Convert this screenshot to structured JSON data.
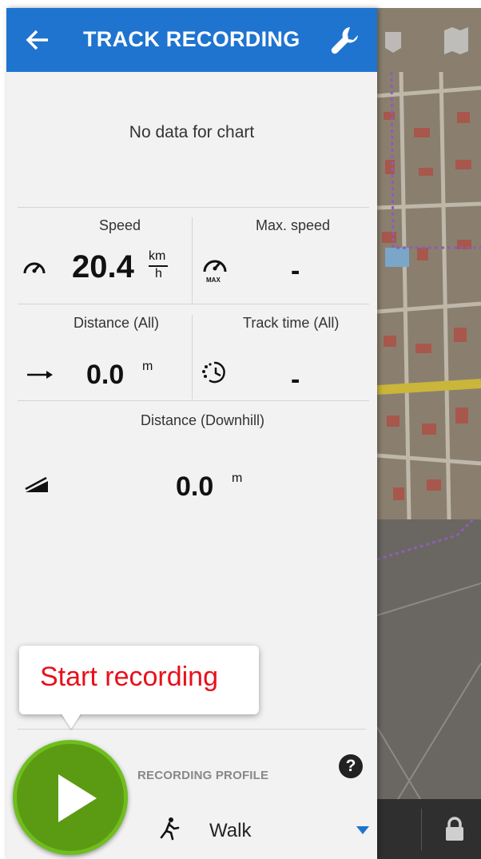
{
  "header": {
    "title": "TRACK RECORDING",
    "back_icon": "arrow-left-icon",
    "settings_icon": "wrench-icon"
  },
  "chart": {
    "empty_message": "No data for chart"
  },
  "stats": {
    "speed": {
      "label": "Speed",
      "value": "20.4",
      "unit_top": "km",
      "unit_bottom": "h",
      "icon": "speedometer-icon"
    },
    "max_speed": {
      "label": "Max. speed",
      "value": "-",
      "icon": "max-speedometer-icon",
      "icon_caption": "MAX"
    },
    "distance_all": {
      "label": "Distance (All)",
      "value": "0.0",
      "unit": "m",
      "icon": "arrow-right-icon"
    },
    "track_time_all": {
      "label": "Track time (All)",
      "value": "-",
      "icon": "timer-icon"
    },
    "distance_downhill": {
      "label": "Distance (Downhill)",
      "value": "0.0",
      "unit": "m",
      "icon": "downhill-icon"
    }
  },
  "tooltip": {
    "text": "Start recording"
  },
  "recording_profile": {
    "label": "RECORDING PROFILE",
    "value": "Walk",
    "icon": "walk-icon",
    "help": "?"
  },
  "colors": {
    "appbar": "#1f74cf",
    "play_button": "#5b9b13",
    "tooltip_text": "#e8101a",
    "dropdown_arrow": "#1f74cf"
  }
}
